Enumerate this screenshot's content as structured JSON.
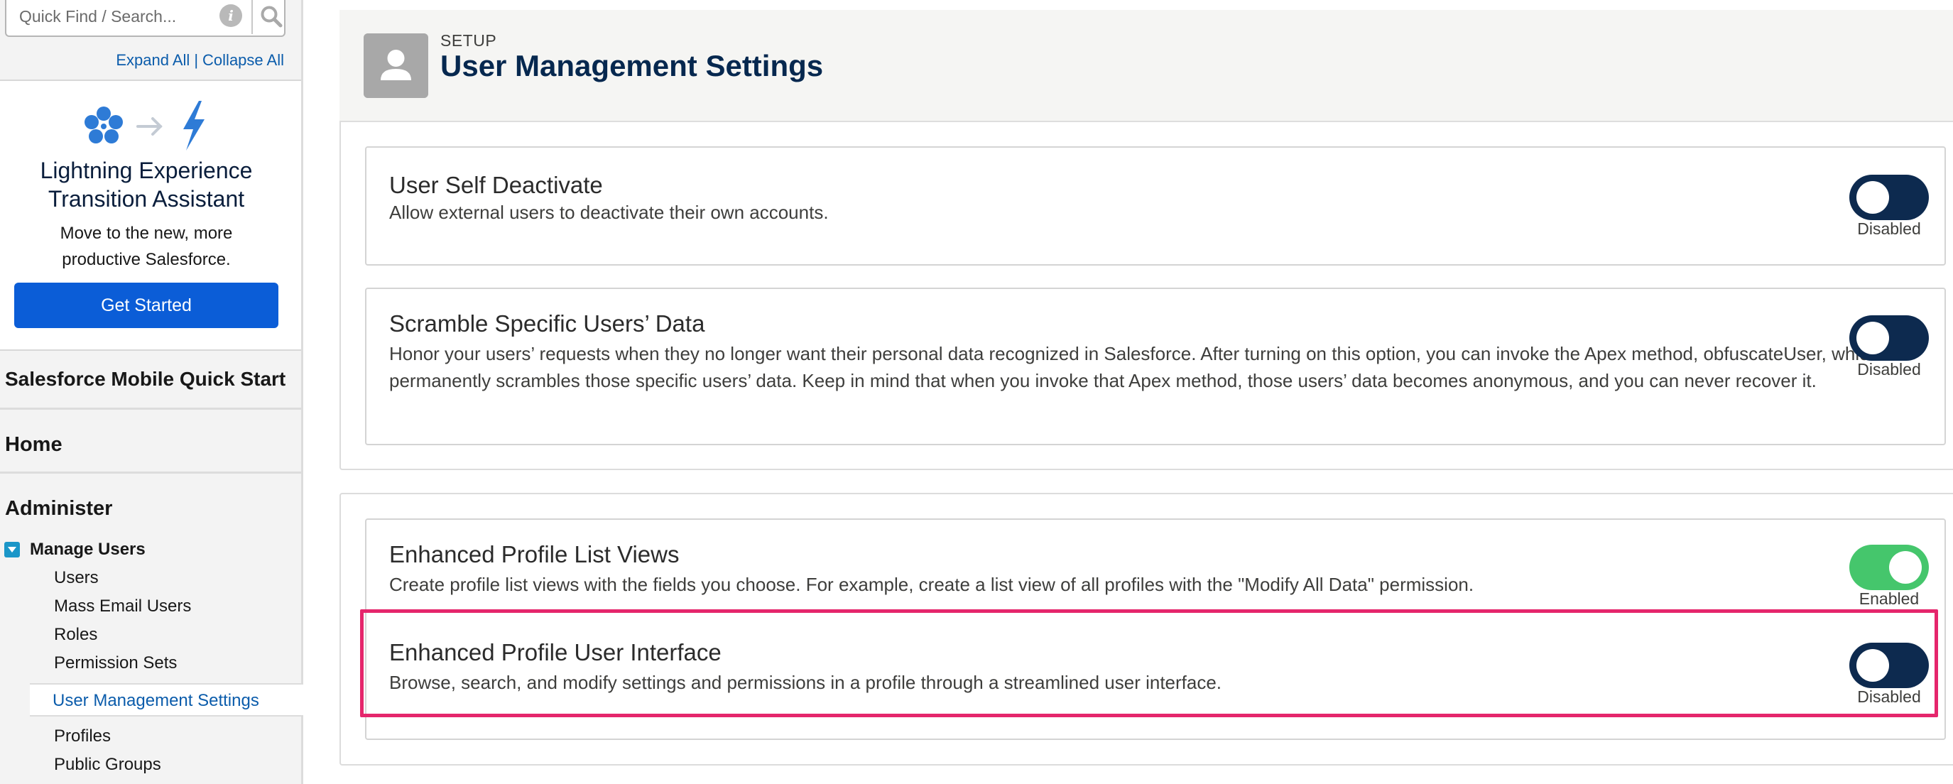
{
  "sidebar": {
    "search": {
      "placeholder": "Quick Find / Search..."
    },
    "expand_all": "Expand All",
    "collapse_all": "Collapse All",
    "separator": "|",
    "lightning": {
      "title_line1": "Lightning Experience",
      "title_line2": "Transition Assistant",
      "desc_line1": "Move to the new, more",
      "desc_line2": "productive Salesforce.",
      "button": "Get Started"
    },
    "sections": {
      "mobile": "Salesforce Mobile Quick Start",
      "home": "Home",
      "administer": "Administer"
    },
    "manage_users": {
      "label": "Manage Users",
      "items": [
        "Users",
        "Mass Email Users",
        "Roles",
        "Permission Sets",
        "User Management Settings",
        "Profiles",
        "Public Groups"
      ],
      "active": "User Management Settings"
    }
  },
  "header": {
    "breadcrumb": "SETUP",
    "title": "User Management Settings"
  },
  "settings": [
    {
      "title": "User Self Deactivate",
      "description": "Allow external users to deactivate their own accounts.",
      "enabled": false,
      "status": "Disabled"
    },
    {
      "title": "Scramble Specific Users’ Data",
      "description": "Honor your users’ requests when they no longer want their personal data recognized in Salesforce. After turning on this option, you can invoke the Apex method, obfuscateUser, which permanently scrambles those specific users’ data. Keep in mind that when you invoke that Apex method, those users’ data becomes anonymous, and you can never recover it.",
      "enabled": false,
      "status": "Disabled"
    },
    {
      "title": "Enhanced Profile List Views",
      "description": "Create profile list views with the fields you choose. For example, create a list view of all profiles with the \"Modify All Data\" permission.",
      "enabled": true,
      "status": "Enabled"
    },
    {
      "title": "Enhanced Profile User Interface",
      "description": "Browse, search, and modify settings and permissions in a profile through a streamlined user interface.",
      "enabled": false,
      "status": "Disabled"
    }
  ],
  "colors": {
    "toggle_off": "#0d2a4f",
    "toggle_on": "#45c66c",
    "highlight": "#e5266c",
    "link": "#0b5cab",
    "primary_button": "#0b5dd7"
  },
  "icons": [
    "info-icon",
    "search-icon",
    "flower-icon",
    "arrow-right-icon",
    "lightning-bolt-icon",
    "collapse-icon",
    "user-icon"
  ]
}
